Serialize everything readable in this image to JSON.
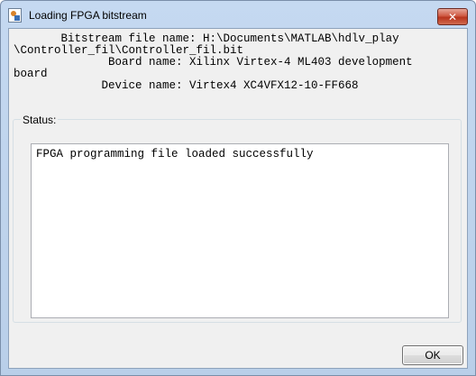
{
  "window": {
    "title": "Loading FPGA bitstream",
    "close_label": "✕"
  },
  "info": {
    "lines": [
      "       Bitstream file name: H:\\Documents\\MATLAB\\hdlv_play",
      "\\Controller_fil\\Controller_fil.bit",
      "              Board name: Xilinx Virtex-4 ML403 development",
      "board",
      "             Device name: Virtex4 XC4VFX12-10-FF668"
    ]
  },
  "status": {
    "label": "Status:",
    "text": "FPGA programming file loaded successfully"
  },
  "buttons": {
    "ok_label": "OK"
  }
}
